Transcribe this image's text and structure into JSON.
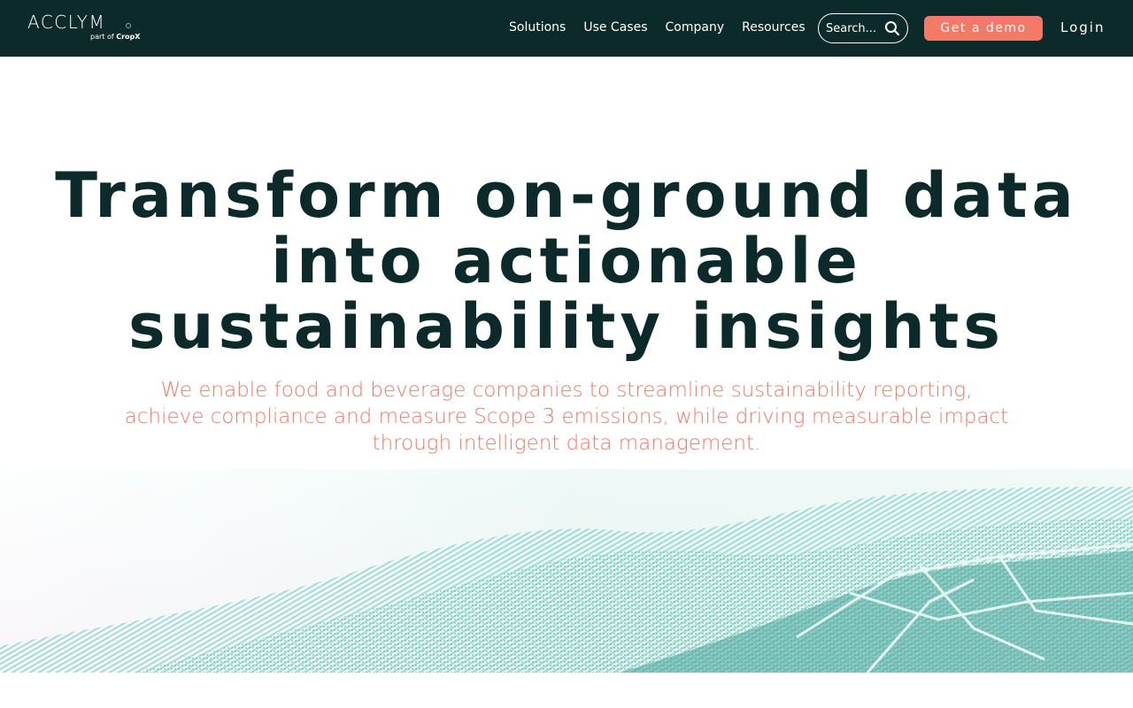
{
  "brand": {
    "logo_text": "ACCLYM",
    "logo_sub_prefix": "part of ",
    "logo_sub_brand": "CropX"
  },
  "nav": {
    "items": [
      "Solutions",
      "Use Cases",
      "Company",
      "Resources"
    ]
  },
  "search": {
    "placeholder": "Search..."
  },
  "actions": {
    "demo_label": "Get a demo",
    "login_label": "Login"
  },
  "hero": {
    "title_line1": "Transform on-ground data",
    "title_line2": "into actionable",
    "title_line3": "sustainability insights",
    "subtitle_line1": "We enable food and beverage companies to streamline sustainability reporting,",
    "subtitle_line2": "achieve compliance and measure Scope 3 emissions, while driving measurable impact",
    "subtitle_line3": "through intelligent data management."
  },
  "colors": {
    "header_bg": "#0d2a2a",
    "accent": "#f47966",
    "title": "#0d2a2a",
    "teal": "#4fc5b0"
  },
  "icons": {
    "search": "search-icon",
    "logo_dot": "circle-icon"
  }
}
